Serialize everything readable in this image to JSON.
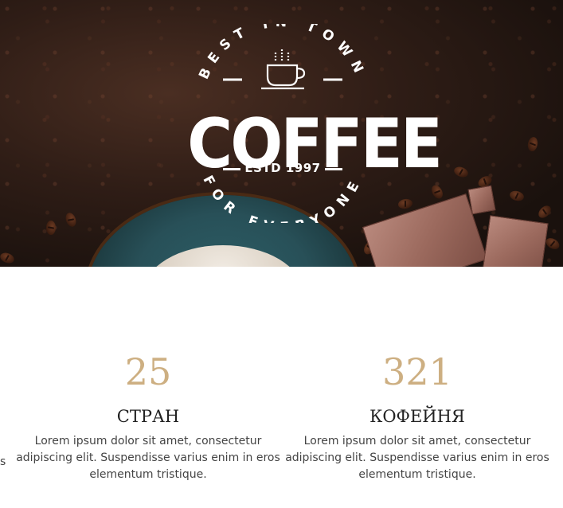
{
  "hero": {
    "logo": {
      "top_arc": "BEST IN TOWN",
      "word": "COFFEE",
      "estd": "ESTD 1997",
      "bottom_arc": "FOR EVERYONE",
      "cup_icon": "coffee-cup-icon"
    }
  },
  "stats": [
    {
      "value": "25",
      "label": "СТРАН",
      "text": "Lorem ipsum dolor sit amet, consectetur adipiscing elit. Suspendisse varius enim in eros elementum tristique."
    },
    {
      "value": "321",
      "label": "КОФЕЙНЯ",
      "text": "Lorem ipsum dolor sit amet, consectetur adipiscing elit. Suspendisse varius enim in eros elementum tristique."
    }
  ],
  "edge_fragment_left": "s",
  "colors": {
    "accent": "#cdaf82",
    "hero_bg": "#2a1a13",
    "plate": "#2c5e66"
  }
}
